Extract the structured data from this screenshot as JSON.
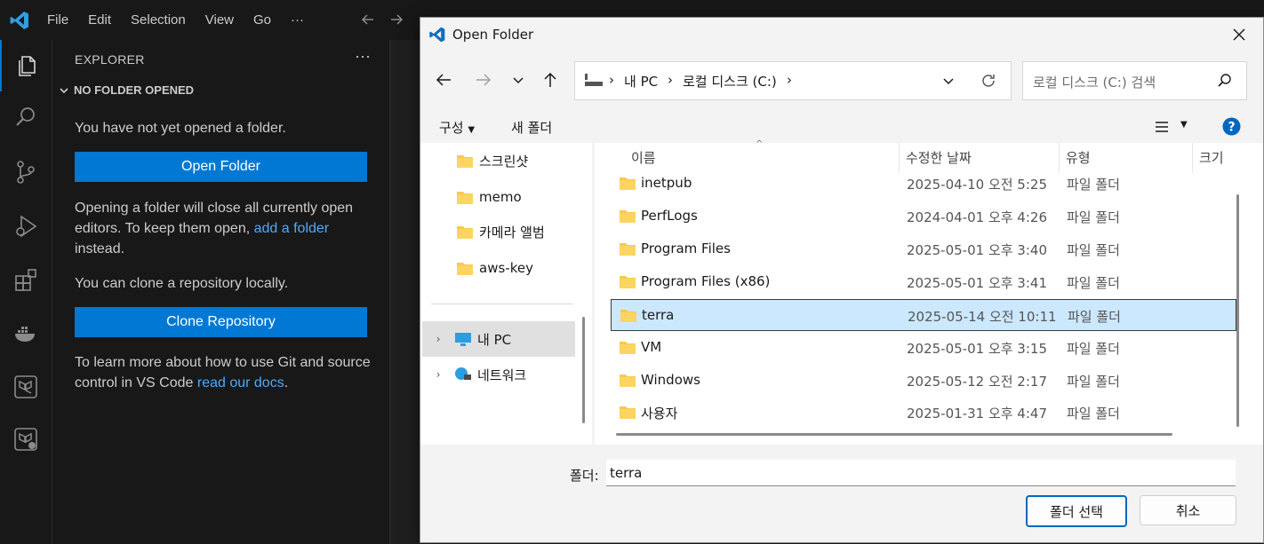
{
  "vscode": {
    "menu": [
      "File",
      "Edit",
      "Selection",
      "View",
      "Go",
      "···"
    ],
    "sidebar": {
      "title": "EXPLORER",
      "more": "···",
      "section": "NO FOLDER OPENED",
      "text1": "You have not yet opened a folder.",
      "open_folder_button": "Open Folder",
      "text2_a": "Opening a folder will close all currently open editors. To keep them open, ",
      "text2_link": "add a folder",
      "text2_b": " instead.",
      "text3": "You can clone a repository locally.",
      "clone_button": "Clone Repository",
      "text4_a": "To learn more about how to use Git and source control in VS Code ",
      "text4_link": "read our docs",
      "text4_b": "."
    },
    "colors": {
      "accent": "#0078d4",
      "link": "#4daafc",
      "bg": "#181818"
    }
  },
  "dialog": {
    "title": "Open Folder",
    "breadcrumb": [
      "내 PC",
      "로컬 디스크 (C:)"
    ],
    "search_placeholder": "로컬 디스크 (C:) 검색",
    "commands": {
      "organize": "구성",
      "new_folder": "새 폴더"
    },
    "nav": {
      "quick": [
        "스크린샷",
        "memo",
        "카메라 앨범",
        "aws-key"
      ],
      "this_pc": "내 PC",
      "network": "네트워크"
    },
    "columns": {
      "name": "이름",
      "modified": "수정한 날짜",
      "type": "유형",
      "size": "크기"
    },
    "rows": [
      {
        "name": "inetpub",
        "date": "2025-04-10 오전 5:25",
        "type": "파일 폴더"
      },
      {
        "name": "PerfLogs",
        "date": "2024-04-01 오후 4:26",
        "type": "파일 폴더"
      },
      {
        "name": "Program Files",
        "date": "2025-05-01 오후 3:40",
        "type": "파일 폴더"
      },
      {
        "name": "Program Files (x86)",
        "date": "2025-05-01 오후 3:41",
        "type": "파일 폴더"
      },
      {
        "name": "terra",
        "date": "2025-05-14 오전 10:11",
        "type": "파일 폴더"
      },
      {
        "name": "VM",
        "date": "2025-05-01 오후 3:15",
        "type": "파일 폴더"
      },
      {
        "name": "Windows",
        "date": "2025-05-12 오전 2:17",
        "type": "파일 폴더"
      },
      {
        "name": "사용자",
        "date": "2025-01-31 오후 4:47",
        "type": "파일 폴더"
      }
    ],
    "selected_index": 4,
    "folder_label": "폴더:",
    "folder_value": "terra",
    "select_button": "폴더 선택",
    "cancel_button": "취소",
    "help": "?"
  }
}
